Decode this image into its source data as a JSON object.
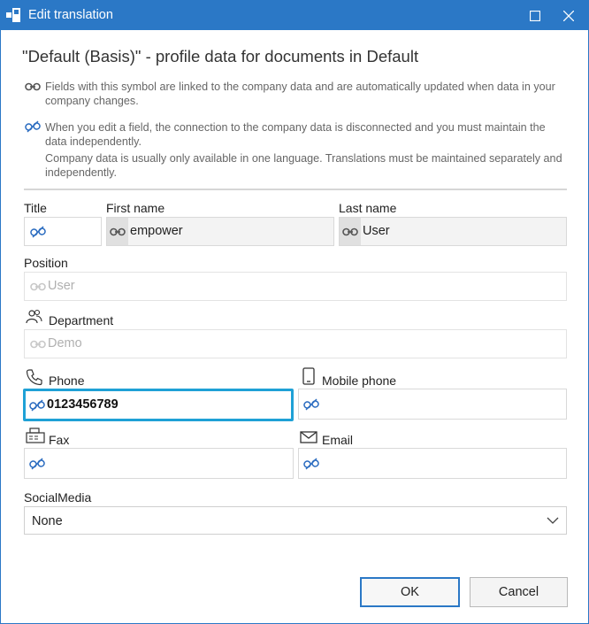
{
  "window": {
    "title": "Edit translation",
    "colors": {
      "titlebar": "#2b78c6",
      "focus": "#1fa1d6",
      "link": "#2b6cc0"
    }
  },
  "heading": "\"Default (Basis)\" - profile data for documents in Default",
  "info": {
    "linked": "Fields with this symbol are linked to the company data and are automatically updated when data in your company changes.",
    "unlinked_1": "When you edit a field, the connection to the company data is disconnected and you must maintain the data independently.",
    "unlinked_2": "Company data is usually only available in one language. Translations must be maintained separately and independently."
  },
  "fields": {
    "title": {
      "label": "Title",
      "value": "",
      "icon": "unlinked-icon"
    },
    "first_name": {
      "label": "First name",
      "value": "empower",
      "icon": "linked-icon"
    },
    "last_name": {
      "label": "Last name",
      "value": "User",
      "icon": "linked-icon"
    },
    "position": {
      "label": "Position",
      "value": "User",
      "icon": "linked-icon"
    },
    "department": {
      "label": "Department",
      "value": "Demo",
      "icon": "linked-icon",
      "label_icon": "people-icon"
    },
    "phone": {
      "label": "Phone",
      "value": "0123456789",
      "icon": "unlinked-icon",
      "label_icon": "phone-icon"
    },
    "mobile": {
      "label": "Mobile phone",
      "value": "",
      "icon": "unlinked-icon",
      "label_icon": "mobile-phone-icon"
    },
    "fax": {
      "label": "Fax",
      "value": "",
      "icon": "unlinked-icon",
      "label_icon": "fax-icon"
    },
    "email": {
      "label": "Email",
      "value": "",
      "icon": "unlinked-icon",
      "label_icon": "envelope-icon"
    },
    "social_media": {
      "label": "SocialMedia",
      "value": "None"
    }
  },
  "buttons": {
    "ok": "OK",
    "cancel": "Cancel"
  }
}
